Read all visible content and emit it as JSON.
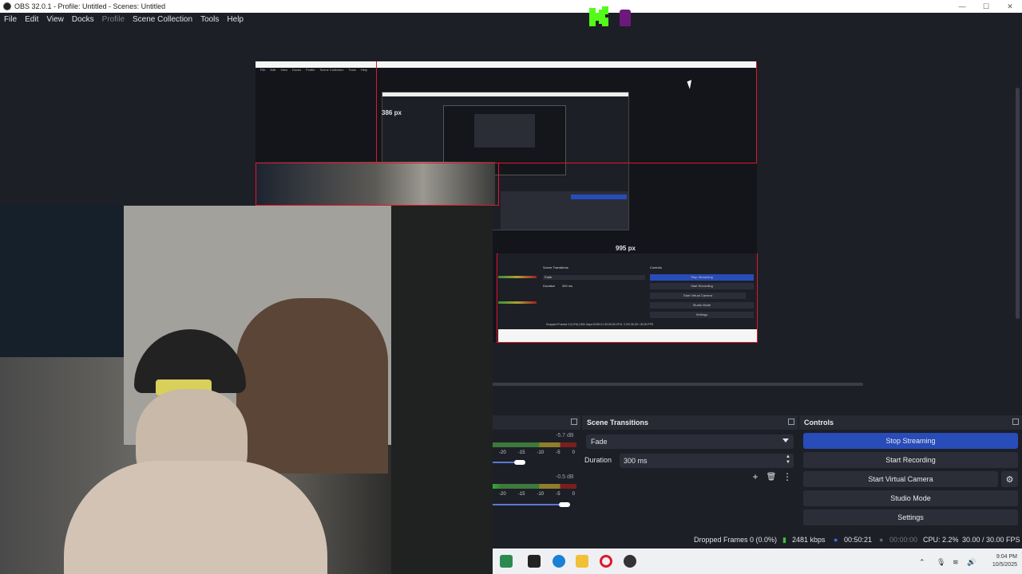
{
  "window": {
    "title": "OBS 32.0.1 - Profile: Untitled - Scenes: Untitled",
    "controls": [
      "—",
      "☐",
      "✕"
    ]
  },
  "menu": {
    "items": [
      "File",
      "Edit",
      "View",
      "Docks",
      "Profile",
      "Scene Collection",
      "Tools",
      "Help"
    ]
  },
  "preview": {
    "label_386": "386 px",
    "label_995": "995 px"
  },
  "nested_obs": {
    "menu_items": [
      "File",
      "Edit",
      "View",
      "Docks",
      "Profile",
      "Scene Collection",
      "Tools",
      "Help"
    ],
    "scene_transitions": "Scene Transitions",
    "controls": "Controls",
    "fade": "Fade",
    "duration": "Duration",
    "duration_value": "300 ms",
    "stop_streaming": "Stop Streaming",
    "start_recording": "Start Recording",
    "start_virtual_camera": "Start Virtual Camera",
    "studio_mode": "Studio Mode",
    "settings": "Settings",
    "status": "Dropped Frames 0 (0.0%)   2481 kbps   00:50:21   00:00:00   CPU: 2.2%   30.00 / 30.00 FPS"
  },
  "audio_mixer": {
    "channels": [
      {
        "db": "-5.7 dB",
        "volume": 0.35,
        "scale": [
          "-20",
          "-15",
          "-10",
          "-5",
          "0"
        ]
      },
      {
        "db": "-0.5 dB",
        "volume": 0.9,
        "scale": [
          "-20",
          "-15",
          "-10",
          "-5",
          "0"
        ]
      }
    ]
  },
  "scene_transitions": {
    "title": "Scene Transitions",
    "transition": "Fade",
    "duration_label": "Duration",
    "duration_value": "300 ms"
  },
  "controls": {
    "title": "Controls",
    "stop_streaming": "Stop Streaming",
    "start_recording": "Start Recording",
    "start_virtual_camera": "Start Virtual Camera",
    "studio_mode": "Studio Mode",
    "settings": "Settings"
  },
  "status": {
    "dropped_frames": "Dropped Frames 0 (0.0%)",
    "bitrate": "2481 kbps",
    "stream_time": "00:50:21",
    "record_time": "00:00:00",
    "cpu": "CPU: 2.2%",
    "fps": "30.00 / 30.00 FPS"
  },
  "taskbar": {
    "time": "9:04 PM",
    "date": "10/5/2025",
    "apps": [
      "camera-app-icon",
      "terminal-icon",
      "edge-icon",
      "folder-icon",
      "opera-icon",
      "obs-icon"
    ]
  },
  "colors": {
    "background": "#1d1f26",
    "accent": "#284cb8",
    "selection_red": "#e0172b",
    "kick_green": "#53fc18"
  }
}
